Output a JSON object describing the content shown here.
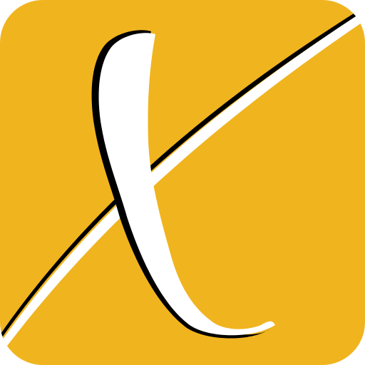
{
  "icon": {
    "name": "x-logo-icon",
    "background_color": "#F0B41F",
    "stroke_color": "#FFFFFF",
    "shadow_color": "#000000"
  }
}
